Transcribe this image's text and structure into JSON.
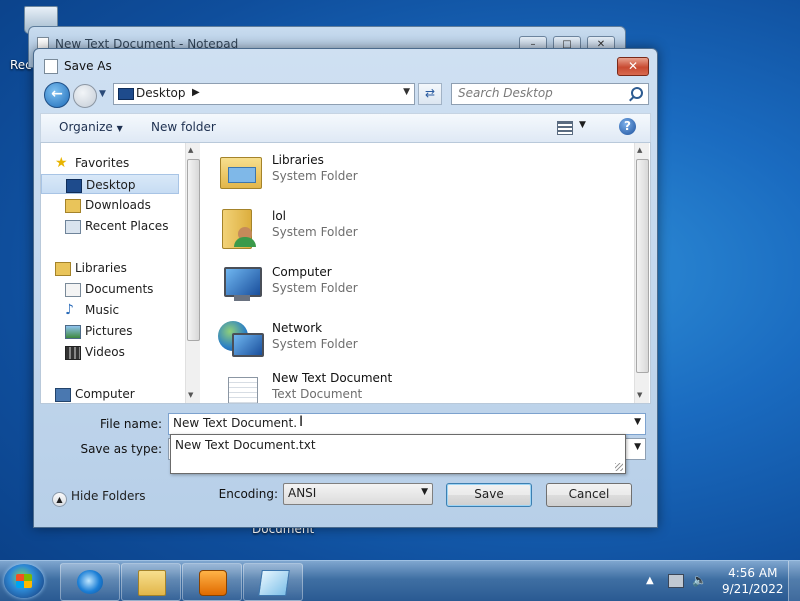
{
  "desktop": {
    "recycle_label": "Rec",
    "document_label": "Document"
  },
  "notepad": {
    "title": "New Text Document - Notepad"
  },
  "dialog": {
    "title": "Save As",
    "address": {
      "location": "Desktop"
    },
    "search": {
      "placeholder": "Search Desktop"
    },
    "toolbar": {
      "organize": "Organize",
      "new_folder": "New folder"
    },
    "nav": {
      "favorites": "Favorites",
      "desktop": "Desktop",
      "downloads": "Downloads",
      "recent_places": "Recent Places",
      "libraries": "Libraries",
      "documents": "Documents",
      "music": "Music",
      "pictures": "Pictures",
      "videos": "Videos",
      "computer": "Computer"
    },
    "files": [
      {
        "name": "Libraries",
        "type": "System Folder",
        "icon": "libraries-folder-icon"
      },
      {
        "name": "lol",
        "type": "System Folder",
        "icon": "user-folder-icon"
      },
      {
        "name": "Computer",
        "type": "System Folder",
        "icon": "computer-icon"
      },
      {
        "name": "Network",
        "type": "System Folder",
        "icon": "network-icon"
      },
      {
        "name": "New Text Document",
        "type": "Text Document",
        "icon": "text-document-icon"
      }
    ],
    "form": {
      "file_name_label": "File name:",
      "file_name_value": "New Text Document.",
      "save_as_type_label": "Save as type:",
      "autocomplete_option": "New Text Document.txt",
      "encoding_label": "Encoding:",
      "encoding_value": "ANSI"
    },
    "buttons": {
      "hide_folders": "Hide Folders",
      "save": "Save",
      "cancel": "Cancel"
    }
  },
  "taskbar": {
    "time": "4:56 AM",
    "date": "9/21/2022"
  },
  "colors": {
    "accent": "#1e6bb8",
    "close": "#c84a31",
    "desktop": "#1a6bc0"
  }
}
